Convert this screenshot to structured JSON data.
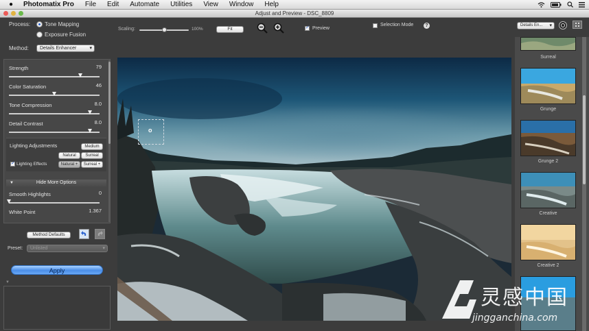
{
  "menubar": {
    "app_name": "Photomatix Pro",
    "items": [
      "File",
      "Edit",
      "Automate",
      "Utilities",
      "View",
      "Window",
      "Help"
    ]
  },
  "window": {
    "title": "Adjust and Preview - DSC_8809"
  },
  "toolbar": {
    "process_label": "Process:",
    "tone_mapping": "Tone Mapping",
    "exposure_fusion": "Exposure Fusion",
    "method_label": "Method:",
    "method_value": "Details Enhancer",
    "scaling_label": "Scaling:",
    "scaling_value": "100%",
    "fit_label": "Fit",
    "preview_label": "Preview",
    "selection_mode_label": "Selection Mode",
    "help_glyph": "?",
    "view_select": "Details En..."
  },
  "settings": {
    "sliders": [
      {
        "label": "Strength",
        "value": "79",
        "fraction": 0.79
      },
      {
        "label": "Color Saturation",
        "value": "46",
        "fraction": 0.5
      },
      {
        "label": "Tone Compression",
        "value": "8.0",
        "fraction": 0.9
      },
      {
        "label": "Detail Contrast",
        "value": "8.0",
        "fraction": 0.9
      }
    ],
    "lighting_title": "Lighting Adjustments",
    "lighting_medium": "Medium",
    "lighting_natural": "Natural",
    "lighting_surreal": "Surreal",
    "lighting_effects_label": "Lighting Effects",
    "lighting_natural_plus": "Natural +",
    "lighting_surreal_plus": "Surreal +",
    "hide_more_options": "Hide More Options",
    "smooth_highlights_label": "Smooth Highlights",
    "smooth_highlights_value": "0",
    "smooth_highlights_fraction": 0.0,
    "white_point_label": "White Point",
    "white_point_value": "1.367"
  },
  "preset": {
    "method_defaults": "Method Defaults",
    "preset_label": "Preset:",
    "preset_value": "Unlisted"
  },
  "apply_label": "Apply",
  "presets_column": [
    {
      "name": "Surreal"
    },
    {
      "name": "Grunge"
    },
    {
      "name": "Grunge 2"
    },
    {
      "name": "Creative"
    },
    {
      "name": "Creative 2"
    }
  ],
  "selection_cursor": "o",
  "watermark": {
    "big": "灵感中国",
    "small": "jingganchina.com"
  }
}
